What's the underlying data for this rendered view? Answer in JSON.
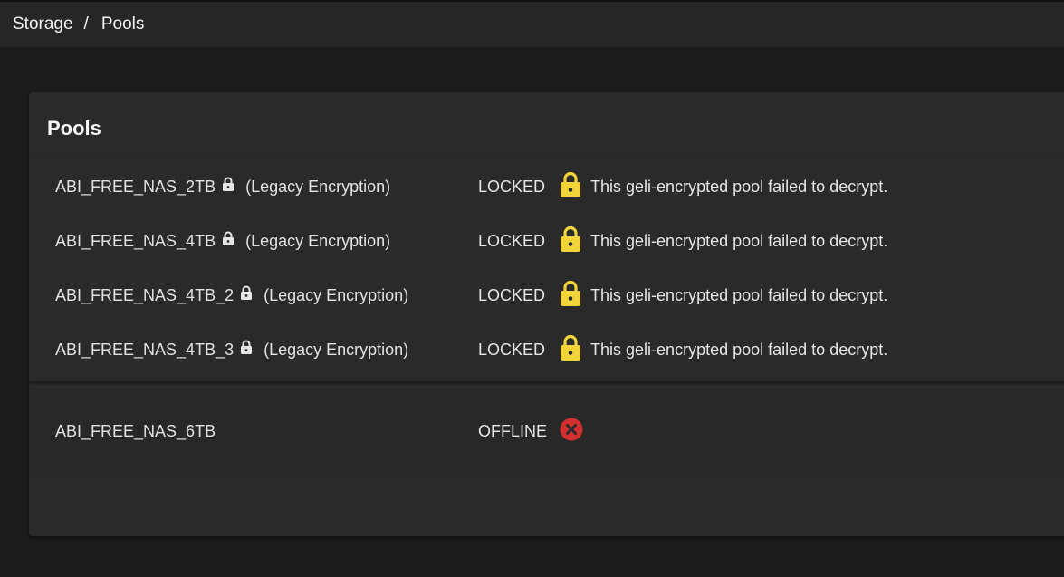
{
  "breadcrumb": {
    "items": [
      "Storage",
      "Pools"
    ],
    "separator": "/"
  },
  "card": {
    "title": "Pools"
  },
  "locked_pools": [
    {
      "name": "ABI_FREE_NAS_2TB",
      "encryption": "(Legacy Encryption)",
      "status": "LOCKED",
      "message": "This geli-encrypted pool failed to decrypt."
    },
    {
      "name": "ABI_FREE_NAS_4TB",
      "encryption": "(Legacy Encryption)",
      "status": "LOCKED",
      "message": "This geli-encrypted pool failed to decrypt."
    },
    {
      "name": "ABI_FREE_NAS_4TB_2",
      "encryption": "(Legacy Encryption)",
      "status": "LOCKED",
      "message": "This geli-encrypted pool failed to decrypt."
    },
    {
      "name": "ABI_FREE_NAS_4TB_3",
      "encryption": "(Legacy Encryption)",
      "status": "LOCKED",
      "message": "This geli-encrypted pool failed to decrypt."
    }
  ],
  "offline_pools": [
    {
      "name": "ABI_FREE_NAS_6TB",
      "status": "OFFLINE"
    }
  ],
  "icons": {
    "small_lock": "lock-icon",
    "status_lock": "lock-icon",
    "status_error": "error-circle-icon"
  },
  "colors": {
    "lock_yellow": "#f0d43a",
    "error_red": "#d32f2f",
    "background": "#1c1c1c",
    "card": "#2a2a2a"
  }
}
